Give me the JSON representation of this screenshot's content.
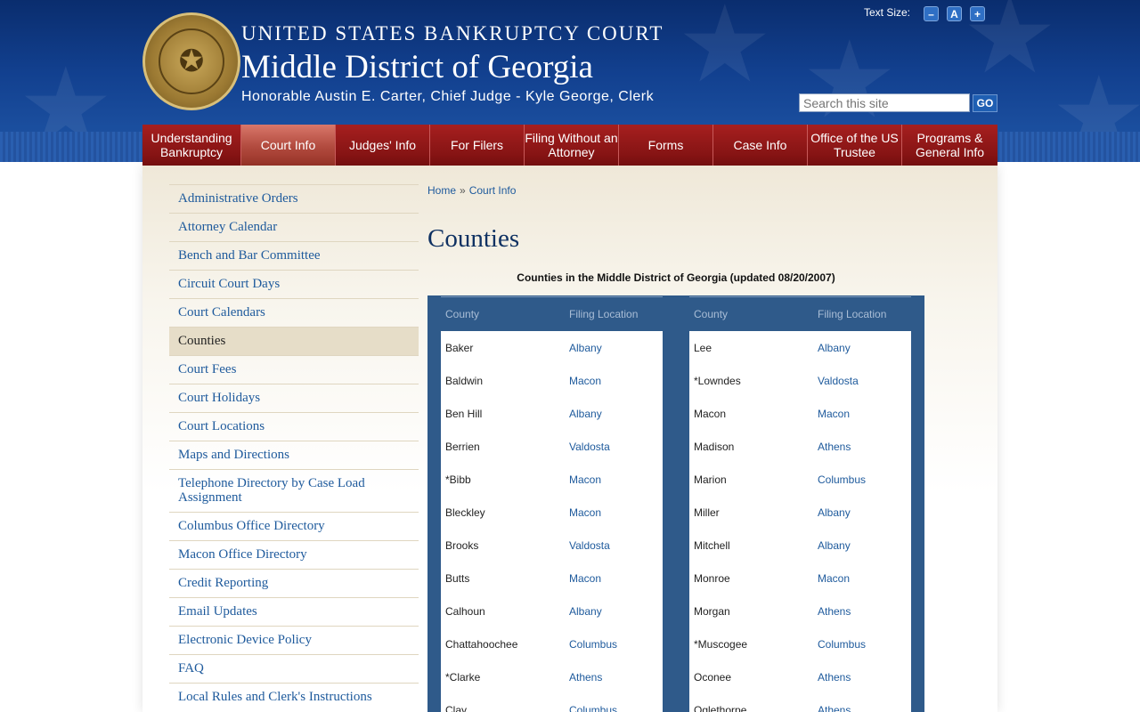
{
  "header": {
    "line1": "UNITED STATES BANKRUPTCY COURT",
    "line2": "Middle District of Georgia",
    "line3": "Honorable Austin E. Carter, Chief Judge - Kyle George, Clerk",
    "seal_icon": "court-seal-icon"
  },
  "text_size": {
    "label": "Text Size:",
    "decrease": "–",
    "reset": "A",
    "increase": "+"
  },
  "search": {
    "placeholder": "Search this site",
    "go_label": "GO"
  },
  "nav": [
    "Understanding Bankruptcy",
    "Court Info",
    "Judges' Info",
    "For Filers",
    "Filing Without an Attorney",
    "Forms",
    "Case Info",
    "Office of the US Trustee",
    "Programs & General Info"
  ],
  "nav_active": "Court Info",
  "sidebar": [
    "Administrative Orders",
    "Attorney Calendar",
    "Bench and Bar Committee",
    "Circuit Court Days",
    "Court Calendars",
    "Counties",
    "Court Fees",
    "Court Holidays",
    "Court Locations",
    "Maps and Directions",
    "Telephone Directory by Case Load Assignment",
    "Columbus Office Directory",
    "Macon Office Directory",
    "Credit Reporting",
    "Email Updates",
    "Electronic Device Policy",
    "FAQ",
    "Local Rules and Clerk's Instructions"
  ],
  "sidebar_active": "Counties",
  "breadcrumb": {
    "home": "Home",
    "separator": "»",
    "current": "Court Info"
  },
  "page_title": "Counties",
  "table": {
    "caption": "Counties in the Middle District of Georgia (updated 08/20/2007)",
    "headers": [
      "County",
      "Filing Location"
    ],
    "left": [
      [
        "Baker",
        "Albany"
      ],
      [
        "Baldwin",
        "Macon"
      ],
      [
        "Ben Hill",
        "Albany"
      ],
      [
        "Berrien",
        "Valdosta"
      ],
      [
        "*Bibb",
        "Macon"
      ],
      [
        "Bleckley",
        "Macon"
      ],
      [
        "Brooks",
        "Valdosta"
      ],
      [
        "Butts",
        "Macon"
      ],
      [
        "Calhoun",
        "Albany"
      ],
      [
        "Chattahoochee",
        "Columbus"
      ],
      [
        "*Clarke",
        "Athens"
      ],
      [
        "Clay",
        "Columbus"
      ]
    ],
    "right": [
      [
        "Lee",
        "Albany"
      ],
      [
        "*Lowndes",
        "Valdosta"
      ],
      [
        "Macon",
        "Macon"
      ],
      [
        "Madison",
        "Athens"
      ],
      [
        "Marion",
        "Columbus"
      ],
      [
        "Miller",
        "Albany"
      ],
      [
        "Mitchell",
        "Albany"
      ],
      [
        "Monroe",
        "Macon"
      ],
      [
        "Morgan",
        "Athens"
      ],
      [
        "*Muscogee",
        "Columbus"
      ],
      [
        "Oconee",
        "Athens"
      ],
      [
        "Oglethorpe",
        "Athens"
      ]
    ]
  },
  "colors": {
    "header_blue": "#12408f",
    "nav_red": "#8c1616",
    "link_blue": "#1e5a9c",
    "table_frame": "#2f5a8a",
    "title_navy": "#0f3162"
  }
}
